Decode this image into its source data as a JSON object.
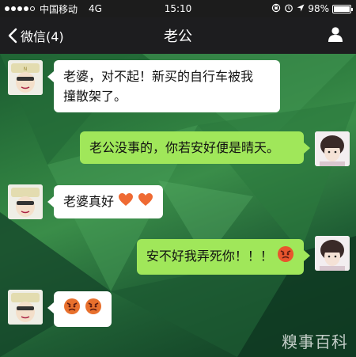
{
  "status_bar": {
    "carrier": "中国移动",
    "network": "4G",
    "time": "15:10",
    "battery_percent": "98%",
    "battery_level": 0.98,
    "signal_bars": 4,
    "icons": [
      "rotation-lock-icon",
      "alarm-icon",
      "location-icon",
      "battery-icon"
    ]
  },
  "nav": {
    "back_label": "微信(4)",
    "title": "老公",
    "profile_icon": "person-icon"
  },
  "messages": [
    {
      "direction": "incoming",
      "text_line1": "老婆，对不起！新买的自行车被我",
      "text_line2": "撞散架了。"
    },
    {
      "direction": "outgoing",
      "text": "老公没事的，你若安好便是晴天。"
    },
    {
      "direction": "incoming",
      "text": "老婆真好",
      "emoji": [
        "heart-icon",
        "heart-icon"
      ]
    },
    {
      "direction": "outgoing",
      "text": "安不好我弄死你！！！",
      "emoji": [
        "angry-face-icon"
      ]
    },
    {
      "direction": "incoming",
      "text": "",
      "emoji": [
        "angry-face-icon",
        "angry-face-icon"
      ]
    }
  ],
  "watermark": "糗事百科",
  "colors": {
    "incoming_bubble": "#ffffff",
    "outgoing_bubble": "#a0e75a",
    "nav_bar": "#1d1d1f",
    "status_bar": "#1c1c1c"
  }
}
